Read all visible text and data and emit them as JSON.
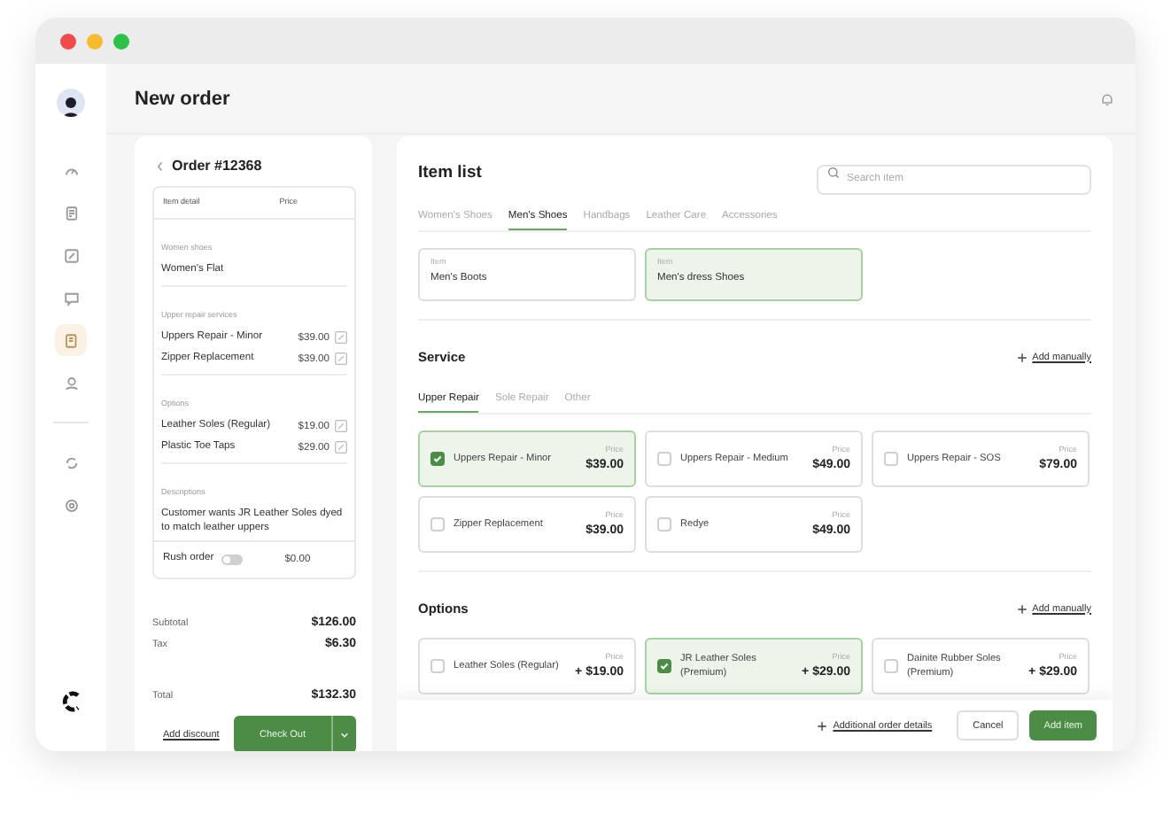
{
  "header": {
    "title": "New order"
  },
  "sidebar": {
    "items": [
      {
        "selected": false
      },
      {
        "selected": false
      },
      {
        "selected": false
      },
      {
        "selected": false
      },
      {
        "selected": true
      },
      {
        "selected": false
      }
    ],
    "bottom_items": [
      {
        "selected": false
      },
      {
        "selected": false
      }
    ]
  },
  "order": {
    "title": "Order #12368",
    "columns": [
      "Item detail",
      "Price"
    ],
    "groups": [
      {
        "label": "Women shoes",
        "lines": [
          {
            "name": "Women's Flat"
          }
        ]
      },
      {
        "label": "Upper repair services",
        "lines": [
          {
            "name": "Uppers Repair - Minor",
            "price": "$39.00"
          },
          {
            "name": "Zipper Replacement",
            "price": "$39.00"
          }
        ]
      },
      {
        "label": "Options",
        "lines": [
          {
            "name": "Leather Soles (Regular)",
            "price": "$19.00"
          },
          {
            "name": "Plastic Toe Taps",
            "price": "$29.00"
          }
        ]
      }
    ],
    "description": {
      "label": "Descriptions",
      "text": "Customer wants JR Leather Soles dyed to match leather uppers"
    },
    "rush": {
      "label": "Rush order",
      "on": false,
      "price": "$0.00"
    },
    "totals": [
      {
        "label": "Subtotal",
        "value": "$126.00"
      },
      {
        "label": "Tax",
        "value": "$6.30"
      }
    ],
    "total": {
      "label": "Total",
      "value": "$132.30"
    },
    "discount_link": "Add discount",
    "checkout": "Check Out"
  },
  "item_list": {
    "title": "Item list",
    "search": {
      "placeholder": "Search item"
    },
    "tabs": [
      {
        "label": "Women's Shoes",
        "selected": false
      },
      {
        "label": "Men's Shoes",
        "selected": true
      },
      {
        "label": "Handbags",
        "selected": false
      },
      {
        "label": "Leather Care",
        "selected": false
      },
      {
        "label": "Accessories",
        "selected": false
      }
    ],
    "cards": [
      {
        "label": "Item",
        "name": "Men's Boots",
        "selected": false
      },
      {
        "label": "Item",
        "name": "Men's dress Shoes",
        "selected": true
      }
    ]
  },
  "service": {
    "title": "Service",
    "add": "Add manually",
    "tabs": [
      {
        "label": "Upper Repair",
        "selected": true
      },
      {
        "label": "Sole Repair",
        "selected": false
      },
      {
        "label": "Other",
        "selected": false
      }
    ],
    "choices": [
      {
        "name": "Uppers Repair - Minor",
        "price_label": "Price",
        "price": "$39.00",
        "checked": true
      },
      {
        "name": "Uppers Repair - Medium",
        "price_label": "Price",
        "price": "$49.00",
        "checked": false
      },
      {
        "name": "Uppers Repair - SOS",
        "price_label": "Price",
        "price": "$79.00",
        "checked": false
      },
      {
        "name": "Zipper Replacement",
        "price_label": "Price",
        "price": "$39.00",
        "checked": false
      },
      {
        "name": "Redye",
        "price_label": "Price",
        "price": "$49.00",
        "checked": false
      }
    ]
  },
  "options": {
    "title": "Options",
    "add": "Add manually",
    "choices": [
      {
        "name": "Leather Soles (Regular)",
        "price_label": "Price",
        "price": "+ $19.00",
        "checked": false
      },
      {
        "name": "JR Leather Soles (Premium)",
        "price_label": "Price",
        "price": "+ $29.00",
        "checked": true
      },
      {
        "name": "Dainite Rubber Soles (Premium)",
        "price_label": "Price",
        "price": "+ $29.00",
        "checked": false
      }
    ]
  },
  "footer": {
    "details_link": "Additional order details",
    "cancel": "Cancel",
    "add": "Add item"
  }
}
